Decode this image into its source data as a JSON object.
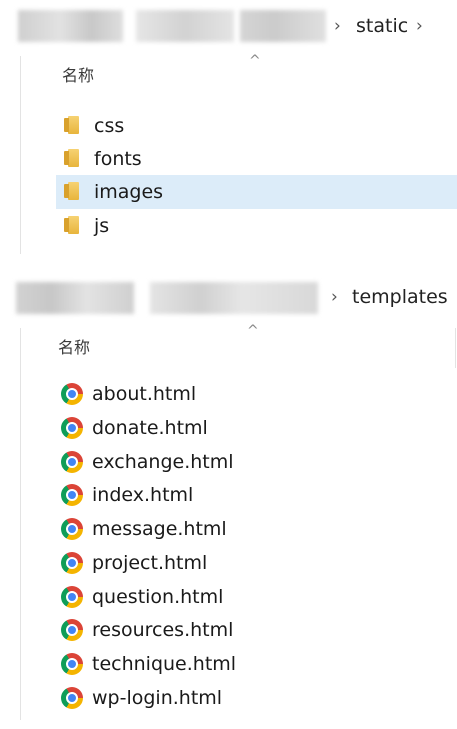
{
  "static_window": {
    "breadcrumb": {
      "current": "static"
    },
    "column_header": "名称",
    "items": [
      {
        "name": "css",
        "selected": false,
        "icon": "folder-icon"
      },
      {
        "name": "fonts",
        "selected": false,
        "icon": "folder-icon"
      },
      {
        "name": "images",
        "selected": true,
        "icon": "folder-icon"
      },
      {
        "name": "js",
        "selected": false,
        "icon": "folder-icon"
      }
    ]
  },
  "templates_window": {
    "breadcrumb": {
      "current": "templates"
    },
    "column_header": "名称",
    "items": [
      {
        "name": "about.html",
        "icon": "chrome-html-icon"
      },
      {
        "name": "donate.html",
        "icon": "chrome-html-icon"
      },
      {
        "name": "exchange.html",
        "icon": "chrome-html-icon"
      },
      {
        "name": "index.html",
        "icon": "chrome-html-icon"
      },
      {
        "name": "message.html",
        "icon": "chrome-html-icon"
      },
      {
        "name": "project.html",
        "icon": "chrome-html-icon"
      },
      {
        "name": "question.html",
        "icon": "chrome-html-icon"
      },
      {
        "name": "resources.html",
        "icon": "chrome-html-icon"
      },
      {
        "name": "technique.html",
        "icon": "chrome-html-icon"
      },
      {
        "name": "wp-login.html",
        "icon": "chrome-html-icon"
      }
    ]
  },
  "colors": {
    "selection": "#dcecf9",
    "folder": "#f2c14e",
    "text": "#1a1a1a"
  }
}
